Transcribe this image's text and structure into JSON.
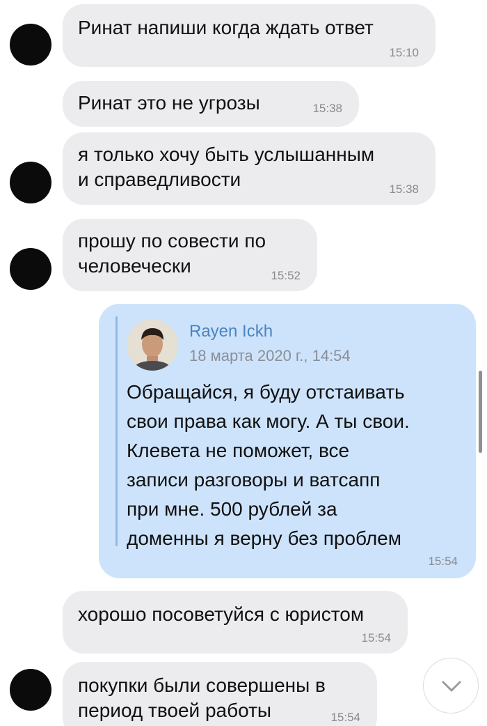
{
  "messages": [
    {
      "text": "Ринат напиши когда ждать ответ",
      "time": "15:10"
    },
    {
      "text": "Ринат это не угрозы",
      "time": "15:38"
    },
    {
      "text": "я только хочу быть услышанным\nи справедливости",
      "time": "15:38"
    },
    {
      "text": "прошу по совести по\nчеловечески",
      "time": "15:52"
    },
    {
      "text": "хорошо посоветуйся с юристом",
      "time": "15:54"
    },
    {
      "text": "покупки были совершены в\nпериод твоей работы",
      "time": "15:54"
    }
  ],
  "forwarded": {
    "author": "Rayen Ickh",
    "date": "18 марта 2020 г., 14:54",
    "text": "Обращайся, я буду отстаивать\nсвои права как могу. А ты свои.\nКлевета не поможет, все\nзаписи разговоры и ватсапп\nпри мне. 500 рублей за\nдоменны я верну без проблем",
    "time": "15:54"
  },
  "icons": {
    "scroll_down": "chevron-down-icon",
    "redacted_avatar": "redacted-avatar"
  },
  "colors": {
    "incoming_bubble": "#ececee",
    "outgoing_bubble": "#cde3fb",
    "author_name": "#4a83c2",
    "timestamp": "#8a8a8e"
  }
}
